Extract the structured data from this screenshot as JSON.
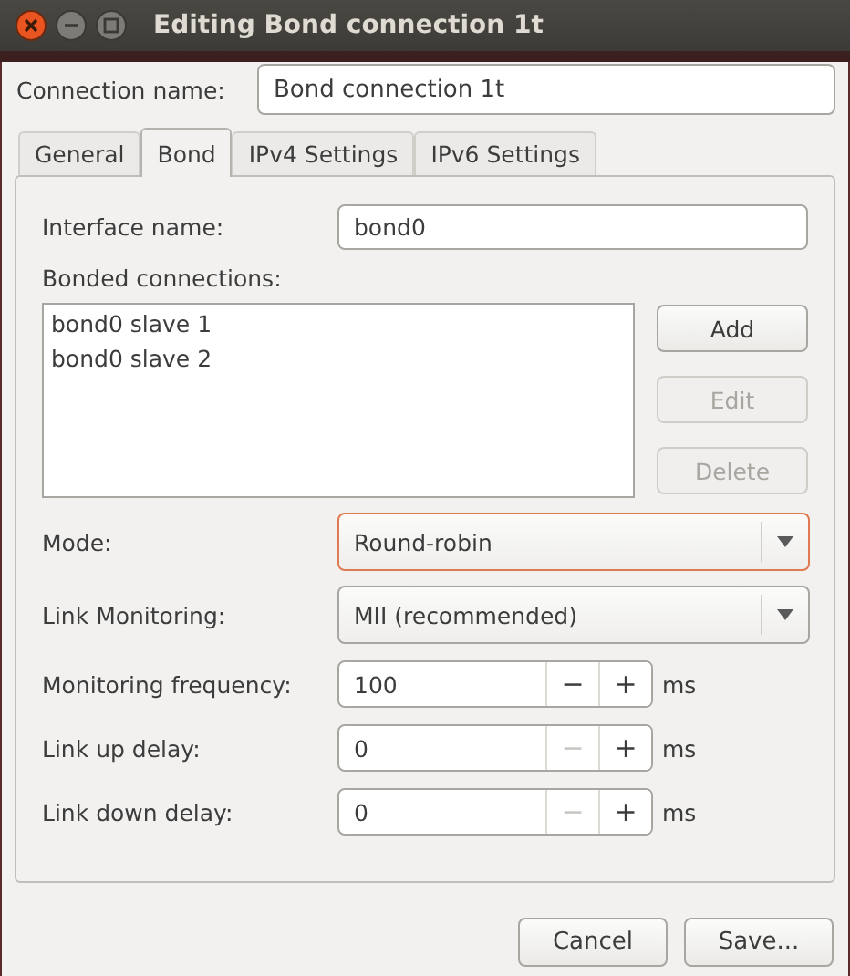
{
  "window": {
    "title": "Editing Bond connection 1t"
  },
  "connection_name": {
    "label": "Connection name:",
    "value": "Bond connection 1t"
  },
  "tabs": [
    {
      "label": "General",
      "selected": false
    },
    {
      "label": "Bond",
      "selected": true
    },
    {
      "label": "IPv4 Settings",
      "selected": false
    },
    {
      "label": "IPv6 Settings",
      "selected": false
    }
  ],
  "interface_name": {
    "label": "Interface name:",
    "value": "bond0"
  },
  "bonded_connections": {
    "label": "Bonded connections:",
    "items": [
      "bond0 slave 1",
      "bond0 slave 2"
    ]
  },
  "list_buttons": [
    {
      "label": "Add",
      "disabled": false
    },
    {
      "label": "Edit",
      "disabled": true
    },
    {
      "label": "Delete",
      "disabled": true
    }
  ],
  "combos": [
    {
      "label": "Mode:",
      "value": "Round-robin",
      "focused": true
    },
    {
      "label": "Link Monitoring:",
      "value": "MII (recommended)",
      "focused": false
    }
  ],
  "spins": [
    {
      "label": "Monitoring frequency:",
      "value": "100",
      "unit": "ms",
      "decrement": {
        "label": "−",
        "disabled": false
      },
      "increment": {
        "label": "+",
        "disabled": false
      }
    },
    {
      "label": "Link up delay:",
      "value": "0",
      "unit": "ms",
      "decrement": {
        "label": "−",
        "disabled": true
      },
      "increment": {
        "label": "+",
        "disabled": false
      }
    },
    {
      "label": "Link down delay:",
      "value": "0",
      "unit": "ms",
      "decrement": {
        "label": "−",
        "disabled": true
      },
      "increment": {
        "label": "+",
        "disabled": false
      }
    }
  ],
  "buttons": [
    {
      "label": "Cancel"
    },
    {
      "label": "Save..."
    }
  ]
}
